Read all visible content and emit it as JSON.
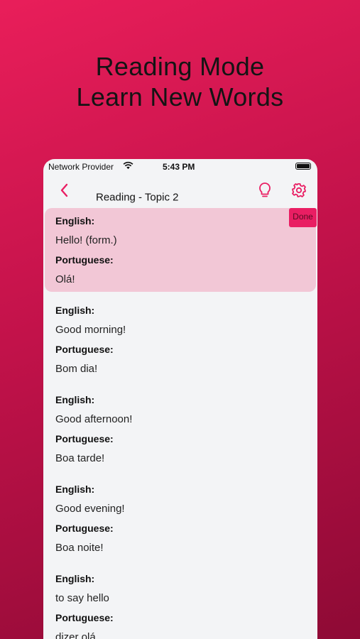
{
  "headline": {
    "line1": "Reading Mode",
    "line2": "Learn New Words"
  },
  "status_bar": {
    "carrier": "Network Provider",
    "time": "5:43 PM"
  },
  "navbar": {
    "title": "Reading - Topic 2"
  },
  "done_label": "Done",
  "cards": [
    {
      "label_en": "English:",
      "english": "Hello! (form.)",
      "label_pt": "Portuguese:",
      "portuguese": "Olá!"
    },
    {
      "label_en": "English:",
      "english": "Good morning!",
      "label_pt": "Portuguese:",
      "portuguese": "Bom dia!"
    },
    {
      "label_en": "English:",
      "english": "Good afternoon!",
      "label_pt": "Portuguese:",
      "portuguese": "Boa tarde!"
    },
    {
      "label_en": "English:",
      "english": "Good evening!",
      "label_pt": "Portuguese:",
      "portuguese": "Boa noite!"
    },
    {
      "label_en": "English:",
      "english": "to say hello",
      "label_pt": "Portuguese:",
      "portuguese": "dizer olá"
    }
  ],
  "colors": {
    "accent": "#e91e63",
    "highlight": "#f2c7d6",
    "background_top": "#e91e5a",
    "background_bottom": "#8e0a35"
  }
}
